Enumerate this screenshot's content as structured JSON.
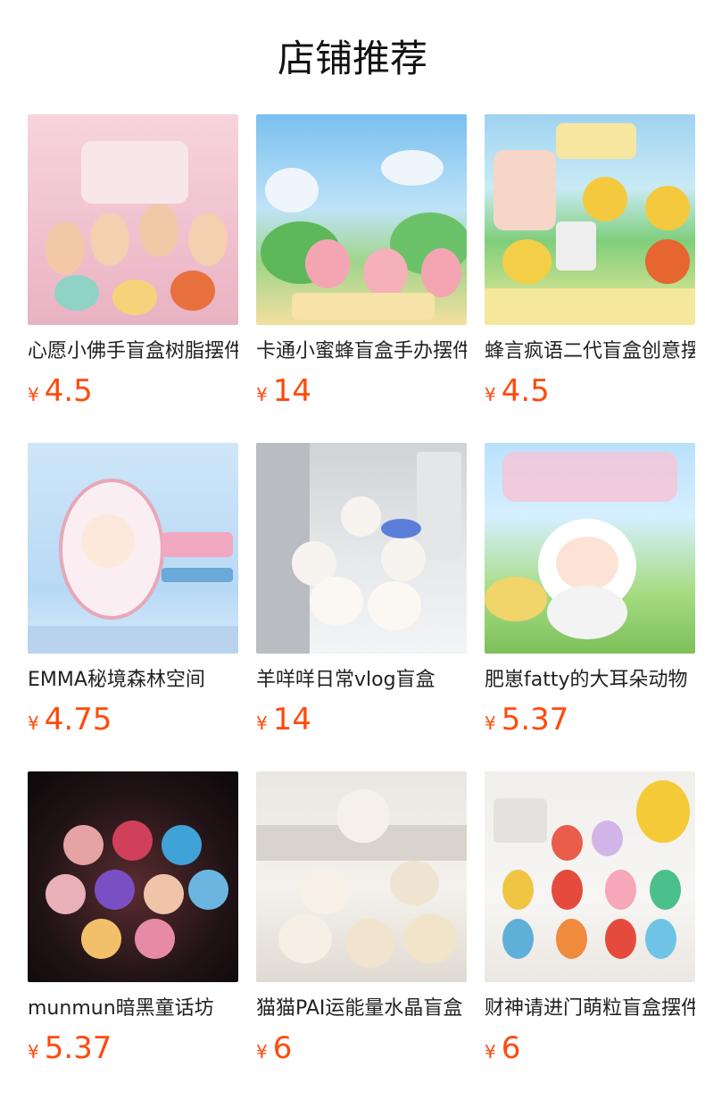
{
  "page": {
    "title": "店铺推荐"
  },
  "currency_symbol": "¥",
  "products": [
    {
      "name": "心愿小佛手盲盒树脂摆件",
      "price": "4.5",
      "thumb_palette": "pink"
    },
    {
      "name": "卡通小蜜蜂盲盒手办摆件",
      "price": "14",
      "thumb_palette": "sky"
    },
    {
      "name": "蜂言疯语二代盲盒创意摆件",
      "price": "4.5",
      "thumb_palette": "party"
    },
    {
      "name": "EMMA秘境森林空间",
      "price": "4.75",
      "thumb_palette": "emma"
    },
    {
      "name": "羊咩咩日常vlog盲盒",
      "price": "14",
      "thumb_palette": "gray"
    },
    {
      "name": "肥崽fatty的大耳朵动物",
      "price": "5.37",
      "thumb_palette": "fatty"
    },
    {
      "name": "munmun暗黑童话坊",
      "price": "5.37",
      "thumb_palette": "dark"
    },
    {
      "name": "猫猫PAI运能量水晶盲盒",
      "price": "6",
      "thumb_palette": "cream"
    },
    {
      "name": "财神请进门萌粒盲盒摆件",
      "price": "6",
      "thumb_palette": "white"
    }
  ]
}
